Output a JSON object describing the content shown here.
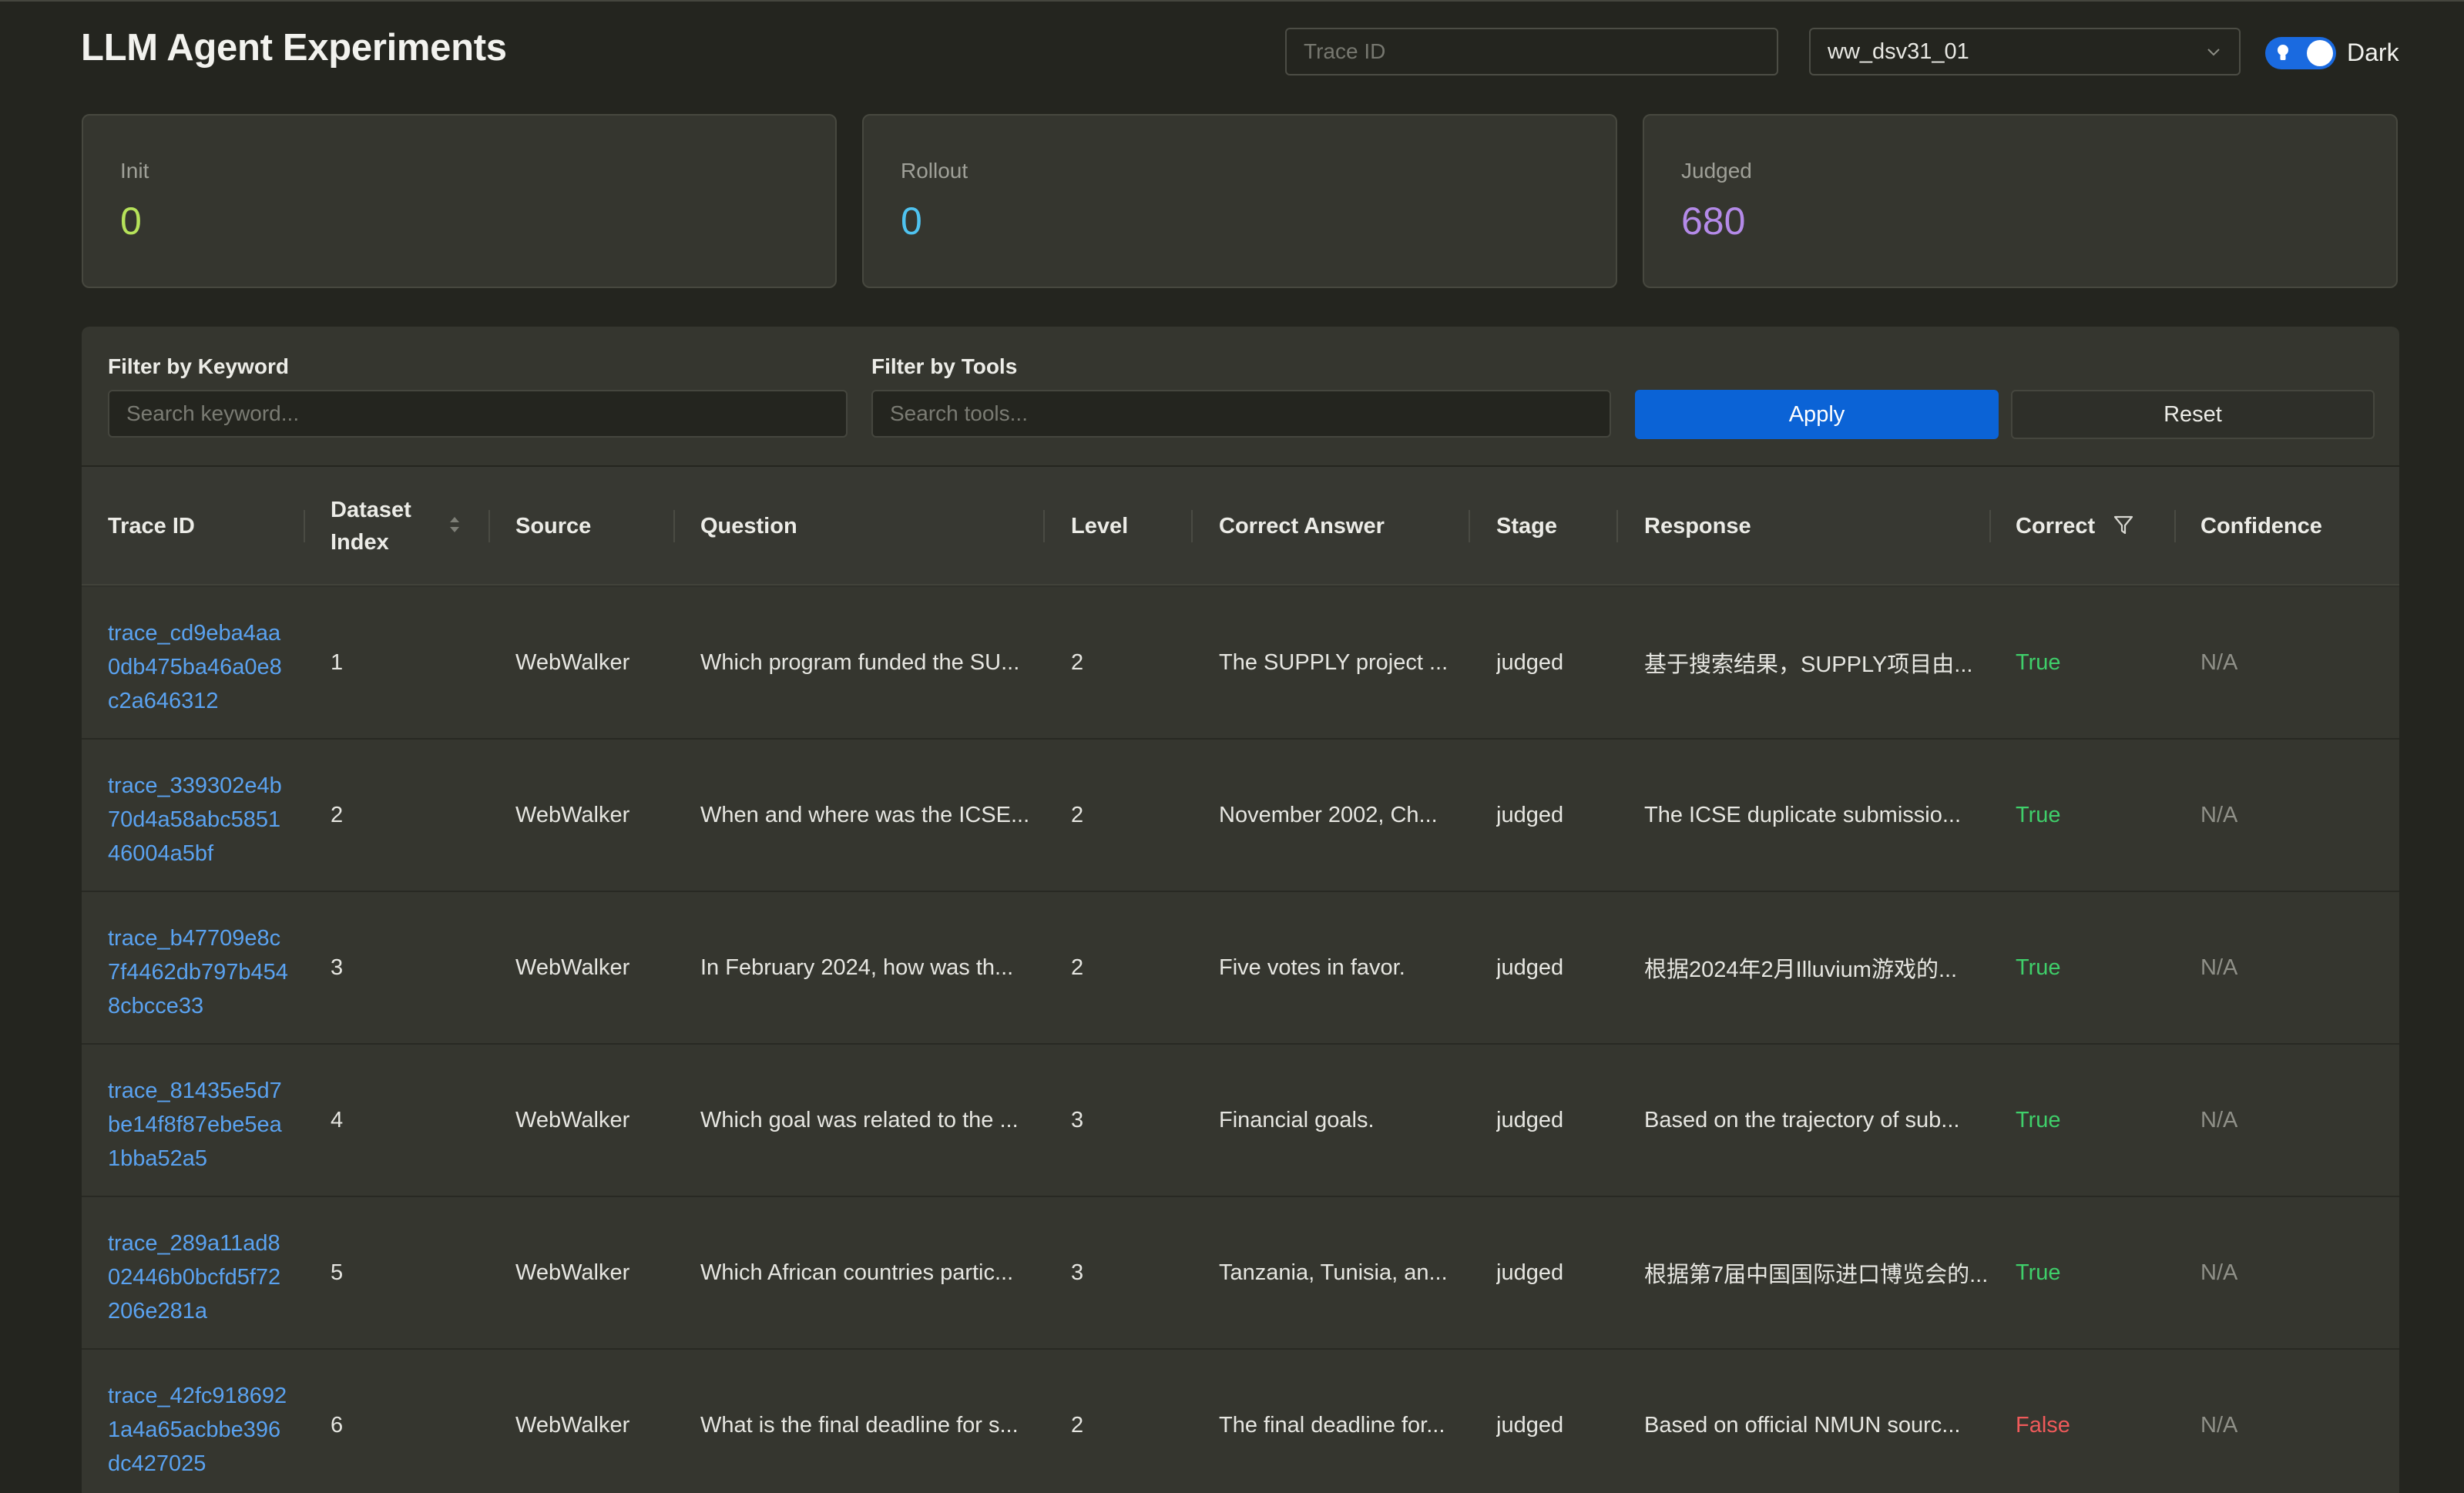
{
  "header": {
    "title": "LLM Agent Experiments",
    "trace_placeholder": "Trace ID",
    "experiment": "ww_dsv31_01",
    "theme_label": "Dark"
  },
  "stats": [
    {
      "label": "Init",
      "value": "0",
      "color": "#b6e35a"
    },
    {
      "label": "Rollout",
      "value": "0",
      "color": "#4fc3f0"
    },
    {
      "label": "Judged",
      "value": "680",
      "color": "#b48ae8"
    }
  ],
  "filters": {
    "keyword_label": "Filter by Keyword",
    "keyword_placeholder": "Search keyword...",
    "tools_label": "Filter by Tools",
    "tools_placeholder": "Search tools...",
    "apply_label": "Apply",
    "reset_label": "Reset"
  },
  "table": {
    "columns": {
      "trace_id": "Trace ID",
      "dataset_index_1": "Dataset",
      "dataset_index_2": "Index",
      "source": "Source",
      "question": "Question",
      "level": "Level",
      "correct_answer": "Correct Answer",
      "stage": "Stage",
      "response": "Response",
      "correct": "Correct",
      "confidence": "Confidence"
    },
    "rows": [
      {
        "trace_id": "trace_cd9eba4aa0db475ba46a0e8c2a646312",
        "index": "1",
        "source": "WebWalker",
        "question": "Which program funded the SU...",
        "level": "2",
        "answer": "The SUPPLY project ...",
        "stage": "judged",
        "response": "基于搜索结果，SUPPLY项目由...",
        "correct": "True",
        "confidence": "N/A"
      },
      {
        "trace_id": "trace_339302e4b70d4a58abc585146004a5bf",
        "index": "2",
        "source": "WebWalker",
        "question": "When and where was the ICSE...",
        "level": "2",
        "answer": "November 2002, Ch...",
        "stage": "judged",
        "response": "The ICSE duplicate submissio...",
        "correct": "True",
        "confidence": "N/A"
      },
      {
        "trace_id": "trace_b47709e8c7f4462db797b4548cbcce33",
        "index": "3",
        "source": "WebWalker",
        "question": "In February 2024, how was th...",
        "level": "2",
        "answer": "Five votes in favor.",
        "stage": "judged",
        "response": "根据2024年2月Illuvium游戏的...",
        "correct": "True",
        "confidence": "N/A"
      },
      {
        "trace_id": "trace_81435e5d7be14f8f87ebe5ea1bba52a5",
        "index": "4",
        "source": "WebWalker",
        "question": "Which goal was related to the ...",
        "level": "3",
        "answer": "Financial goals.",
        "stage": "judged",
        "response": "Based on the trajectory of sub...",
        "correct": "True",
        "confidence": "N/A"
      },
      {
        "trace_id": "trace_289a11ad802446b0bcfd5f72206e281a",
        "index": "5",
        "source": "WebWalker",
        "question": "Which African countries partic...",
        "level": "3",
        "answer": "Tanzania, Tunisia, an...",
        "stage": "judged",
        "response": "根据第7届中国国际进口博览会的...",
        "correct": "True",
        "confidence": "N/A"
      },
      {
        "trace_id": "trace_42fc9186921a4a65acbbe396dc427025",
        "index": "6",
        "source": "WebWalker",
        "question": "What is the final deadline for s...",
        "level": "2",
        "answer": "The final deadline for...",
        "stage": "judged",
        "response": "Based on official NMUN sourc...",
        "correct": "False",
        "confidence": "N/A"
      }
    ]
  }
}
